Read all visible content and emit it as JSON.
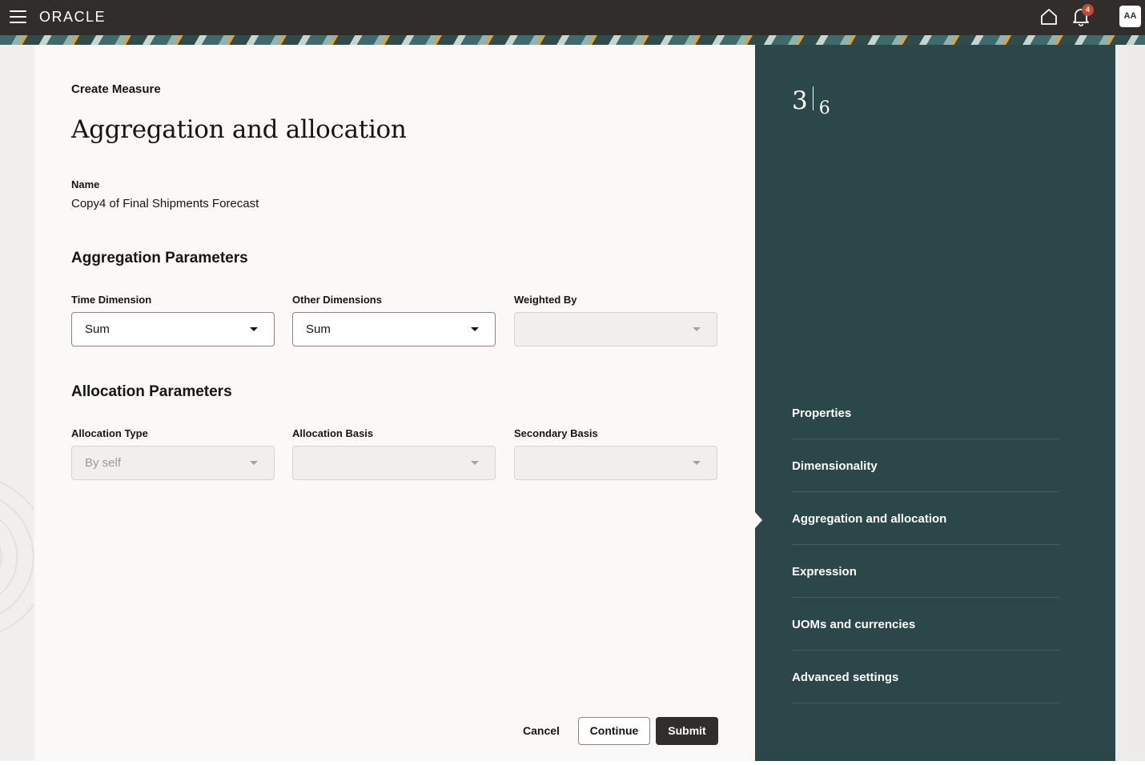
{
  "header": {
    "logo": "ORACLE",
    "notification_count": "4",
    "avatar_initials": "AA"
  },
  "page": {
    "breadcrumb": "Create Measure",
    "title": "Aggregation and allocation",
    "name_label": "Name",
    "name_value": "Copy4 of Final Shipments Forecast"
  },
  "aggregation": {
    "title": "Aggregation Parameters",
    "time_dimension": {
      "label": "Time Dimension",
      "value": "Sum"
    },
    "other_dimensions": {
      "label": "Other Dimensions",
      "value": "Sum"
    },
    "weighted_by": {
      "label": "Weighted By",
      "value": ""
    }
  },
  "allocation": {
    "title": "Allocation Parameters",
    "allocation_type": {
      "label": "Allocation Type",
      "value": "By self"
    },
    "allocation_basis": {
      "label": "Allocation Basis",
      "value": ""
    },
    "secondary_basis": {
      "label": "Secondary Basis",
      "value": ""
    }
  },
  "actions": {
    "cancel": "Cancel",
    "continue": "Continue",
    "submit": "Submit"
  },
  "stepper": {
    "current": "3",
    "total": "6",
    "steps": [
      {
        "label": "Properties"
      },
      {
        "label": "Dimensionality"
      },
      {
        "label": "Aggregation and allocation"
      },
      {
        "label": "Expression"
      },
      {
        "label": "UOMs and currencies"
      },
      {
        "label": "Advanced settings"
      }
    ],
    "active_index": 2
  },
  "colors": {
    "header_bg": "#312d2a",
    "panel_bg": "#2c474a",
    "badge": "#c74634",
    "primary_button": "#312d2a"
  },
  "icons": {
    "menu": "hamburger-menu-icon",
    "home": "home-icon",
    "notifications": "bell-icon"
  }
}
